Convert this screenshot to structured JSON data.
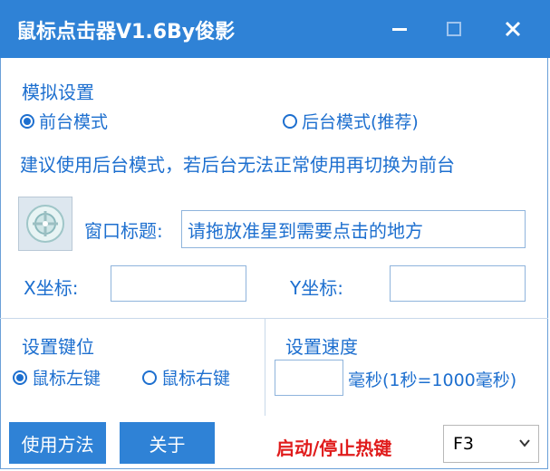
{
  "window": {
    "title": "鼠标点击器V1.6By俊影",
    "minimize_icon": "minimize-icon",
    "maximize_icon": "maximize-icon",
    "close_icon": "close-icon",
    "accent_color": "#2f82d6"
  },
  "simulation": {
    "group_label": "模拟设置",
    "mode_foreground": "前台模式",
    "mode_background": "后台模式(推荐)",
    "selected_mode": "前台模式",
    "hint": "建议使用后台模式，若后台无法正常使用再切换为前台",
    "crosshair_icon": "crosshair-drag-icon",
    "window_title_label": "窗口标题:",
    "window_title_value": "请拖放准星到需要点击的地方",
    "x_label": "X坐标:",
    "x_value": "",
    "y_label": "Y坐标:",
    "y_value": ""
  },
  "key_settings": {
    "group_label": "设置键位",
    "left_key": "鼠标左键",
    "right_key": "鼠标右键",
    "selected_key": "鼠标左键"
  },
  "speed": {
    "group_label": "设置速度",
    "value": "",
    "unit_label": "毫秒(1秒=1000毫秒)"
  },
  "footer": {
    "usage_button": "使用方法",
    "about_button": "关于",
    "hotkey_label": "启动/停止热键",
    "hotkey_value": "F3"
  }
}
